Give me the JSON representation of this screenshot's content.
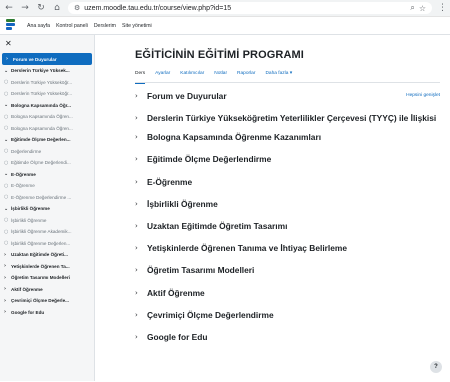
{
  "browser": {
    "url": "uzem.moodle.tau.edu.tr/course/view.php?id=15"
  },
  "site_nav": {
    "links": [
      "Ana sayfa",
      "Kontrol paneli",
      "Derslerim",
      "Site yönetimi"
    ]
  },
  "drawer": {
    "items": [
      {
        "label": "Forum ve Duyurular",
        "type": "active"
      },
      {
        "label": "Derslerin Türkiye Yüksek...",
        "type": "section"
      },
      {
        "label": "Derslerin Türkiye Yükseköğr...",
        "type": "sub"
      },
      {
        "label": "Derslerin Türkiye Yükseköğr...",
        "type": "sub"
      },
      {
        "label": "Bologna Kapsamında Öğr...",
        "type": "section"
      },
      {
        "label": "Bologna Kapsamında Öğren...",
        "type": "sub"
      },
      {
        "label": "Bologna Kapsamında Öğren...",
        "type": "sub"
      },
      {
        "label": "Eğitimde Ölçme Değerlen...",
        "type": "section"
      },
      {
        "label": "Değerlendirme",
        "type": "sub"
      },
      {
        "label": "Eğitimde Ölçme Değerlendi...",
        "type": "sub"
      },
      {
        "label": "E-Öğrenme",
        "type": "section"
      },
      {
        "label": "E-Öğrenme",
        "type": "sub"
      },
      {
        "label": "E-Öğrenme Değerlendirme ...",
        "type": "sub"
      },
      {
        "label": "İşbirlikli Öğrenme",
        "type": "section"
      },
      {
        "label": "İşbirlikli Öğrenme",
        "type": "sub"
      },
      {
        "label": "İşbirlikli Öğrenme Akademik...",
        "type": "sub"
      },
      {
        "label": "İşbirlikli Öğrenme Değerlen...",
        "type": "sub"
      },
      {
        "label": "Uzaktan Eğitimde Öğreti...",
        "type": "collapsed"
      },
      {
        "label": "Yetişkinlerde Öğrenen Ta...",
        "type": "collapsed"
      },
      {
        "label": "Öğretim Tasarımı Modelleri",
        "type": "collapsed"
      },
      {
        "label": "Aktif Öğrenme",
        "type": "collapsed"
      },
      {
        "label": "Çevrimiçi Ölçme Değerle...",
        "type": "collapsed"
      },
      {
        "label": "Google for Edu",
        "type": "collapsed"
      }
    ]
  },
  "course": {
    "title": "EĞİTİCİNİN EĞİTİMİ PROGRAMI",
    "tabs": [
      "Ders",
      "Ayarlar",
      "Katılımcılar",
      "Notlar",
      "Raporlar",
      "Daha fazla ▾"
    ],
    "expand_all": "Hepsini genişlet",
    "sections": [
      "Forum ve Duyurular",
      "Derslerin Türkiye Yükseköğretim Yeterlilikler Çerçevesi (TYYÇ) ile İlişkisi",
      "Bologna Kapsamında Öğrenme Kazanımları",
      "Eğitimde Ölçme Değerlendirme",
      "E-Öğrenme",
      "İşbirlikli Öğrenme",
      "Uzaktan Eğitimde Öğretim Tasarımı",
      "Yetişkinlerde Öğrenen Tanıma ve İhtiyaç Belirleme",
      "Öğretim Tasarımı Modelleri",
      "Aktif Öğrenme",
      "Çevrimiçi Ölçme Değerlendirme",
      "Google for Edu"
    ]
  },
  "help": {
    "label": "?"
  },
  "colors": {
    "accent": "#0f6cbf",
    "drawer_bg": "#f5f6f7"
  }
}
